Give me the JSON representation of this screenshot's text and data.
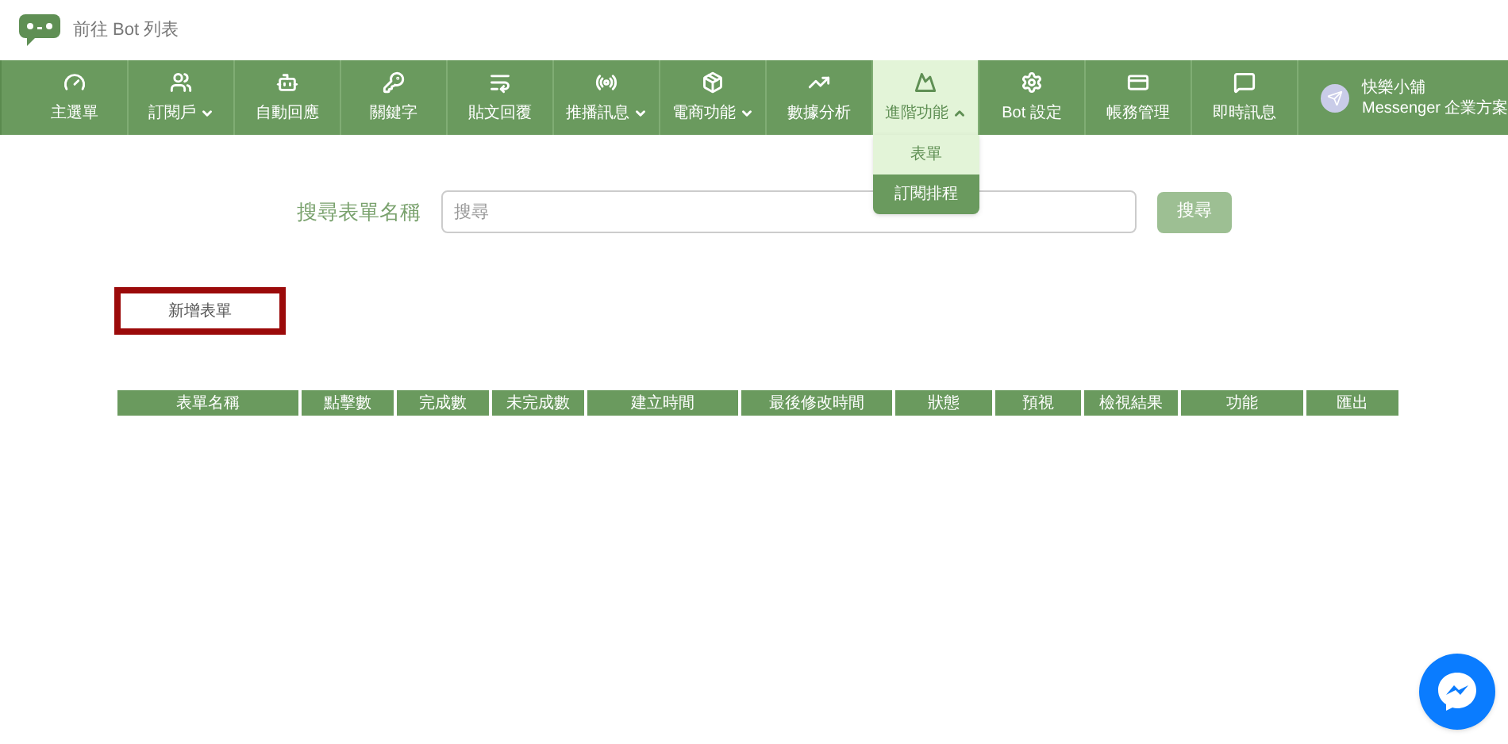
{
  "header": {
    "back_link": "前往 Bot 列表"
  },
  "nav": {
    "items": [
      {
        "label": "主選單",
        "dropdown": false,
        "expanded": false,
        "selected": false
      },
      {
        "label": "訂閱戶",
        "dropdown": true,
        "expanded": false,
        "selected": false
      },
      {
        "label": "自動回應",
        "dropdown": false,
        "expanded": false,
        "selected": false
      },
      {
        "label": "關鍵字",
        "dropdown": false,
        "expanded": false,
        "selected": false
      },
      {
        "label": "貼文回覆",
        "dropdown": false,
        "expanded": false,
        "selected": false
      },
      {
        "label": "推播訊息",
        "dropdown": true,
        "expanded": false,
        "selected": false
      },
      {
        "label": "電商功能",
        "dropdown": true,
        "expanded": false,
        "selected": false
      },
      {
        "label": "數據分析",
        "dropdown": false,
        "expanded": false,
        "selected": false
      },
      {
        "label": "進階功能",
        "dropdown": true,
        "expanded": true,
        "selected": true
      },
      {
        "label": "Bot 設定",
        "dropdown": false,
        "expanded": false,
        "selected": false
      },
      {
        "label": "帳務管理",
        "dropdown": false,
        "expanded": false,
        "selected": false
      },
      {
        "label": "即時訊息",
        "dropdown": false,
        "expanded": false,
        "selected": false
      }
    ],
    "profile": {
      "name": "快樂小舖",
      "plan": "Messenger 企業方案"
    },
    "dropdown_menu": [
      {
        "label": "表單",
        "selected": false
      },
      {
        "label": "訂閱排程",
        "selected": true
      }
    ]
  },
  "search": {
    "label": "搜尋表單名稱",
    "placeholder": "搜尋",
    "button": "搜尋"
  },
  "add_button": "新增表單",
  "table": {
    "columns": [
      "表單名稱",
      "點擊數",
      "完成數",
      "未完成數",
      "建立時間",
      "最後修改時間",
      "狀態",
      "預視",
      "檢視結果",
      "功能",
      "匯出"
    ]
  }
}
